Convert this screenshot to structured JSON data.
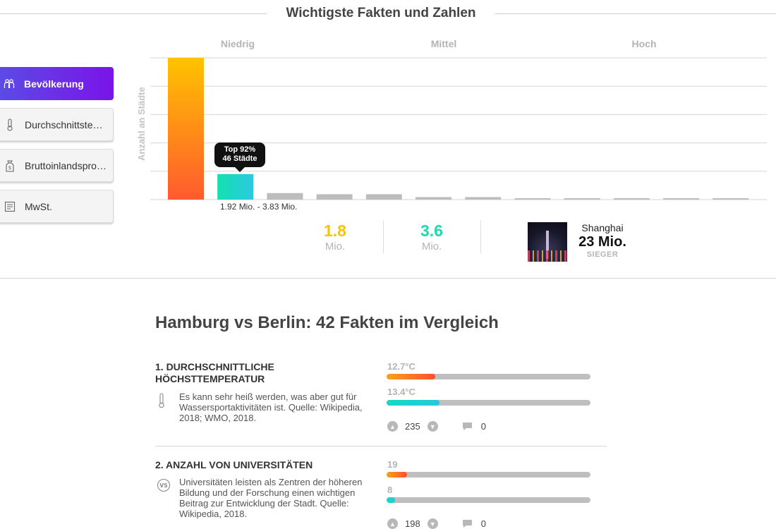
{
  "header": {
    "title": "Wichtigste Fakten und Zahlen"
  },
  "sidebar": {
    "tabs": [
      {
        "label": "Bevölkerung",
        "icon": "people-icon",
        "active": true
      },
      {
        "label": "Durchschnittste…",
        "icon": "thermometer-icon",
        "active": false
      },
      {
        "label": "Bruttoinlandspro…",
        "icon": "money-bag-icon",
        "active": false
      },
      {
        "label": "MwSt.",
        "icon": "receipt-icon",
        "active": false
      }
    ]
  },
  "chart": {
    "bands": [
      "Niedrig",
      "Mittel",
      "Hoch"
    ],
    "ylabel": "Anzahl an Städte",
    "tooltip": {
      "line1": "Top 92%",
      "line2": "46 Städte"
    },
    "range_label": "1.92 Mio. - 3.83 Mio."
  },
  "chart_data": {
    "type": "bar",
    "ylabel": "Anzahl an Städte",
    "categories": [
      "Niedrig",
      "",
      "",
      "",
      "",
      "Mittel",
      "",
      "",
      "",
      "Hoch",
      "",
      ""
    ],
    "values": [
      50,
      9,
      2.3,
      1.9,
      1.9,
      0.9,
      0.9,
      0.5,
      0.5,
      0.3,
      0.5,
      0.5
    ],
    "highlighted_index": 1,
    "ylim": [
      0,
      50
    ],
    "grid": true,
    "colors": {
      "first": "#ff6a2a",
      "highlight": "#1ed8c8",
      "default": "#bdbdbd"
    }
  },
  "stats": {
    "hamburg": {
      "value": "1.8",
      "unit": "Mio.",
      "color": "#f7c400"
    },
    "berlin": {
      "value": "3.6",
      "unit": "Mio.",
      "color": "#1ed8b0"
    },
    "winner": {
      "city": "Shanghai",
      "value": "23 Mio.",
      "tag": "SIEGER"
    }
  },
  "facts_title": "Hamburg vs Berlin: 42 Fakten im Vergleich",
  "facts": [
    {
      "title": "1. Durchschnittliche Höchsttemperatur",
      "icon": "thermometer-icon",
      "desc": "Es kann sehr heiß werden, was aber gut für Wassersportaktivitäten ist. Quelle: Wikipedia, 2018; WMO, 2018.",
      "a_label": "12.7°C",
      "a_fraction": 0.24,
      "b_label": "13.4°C",
      "b_fraction": 0.26,
      "votes": "235",
      "comments": "0"
    },
    {
      "title": "2. Anzahl von Universitäten",
      "icon": "vs-icon",
      "desc": "Universitäten leisten als Zentren der höheren Bildung und der Forschung einen wichtigen Beitrag zur Entwicklung der Stadt. Quelle: Wikipedia, 2018.",
      "a_label": "19",
      "a_fraction": 0.1,
      "b_label": "8",
      "b_fraction": 0.04,
      "votes": "198",
      "comments": "0"
    }
  ]
}
